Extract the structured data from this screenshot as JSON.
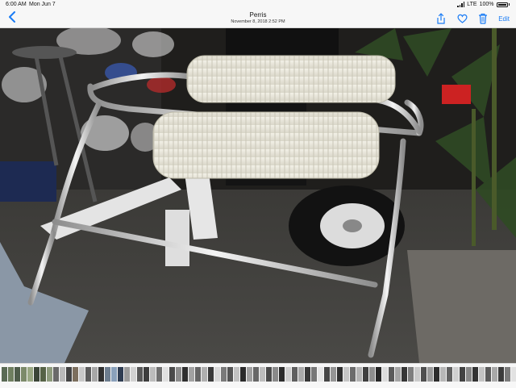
{
  "status_bar": {
    "time": "6:00 AM",
    "date": "Mon Jun 7",
    "carrier": "LTE",
    "battery": "100%",
    "battery_level": 1.0
  },
  "nav": {
    "title": "Perris",
    "subtitle": "November 8, 2018  2:52 PM",
    "edit_label": "Edit",
    "accent_color": "#1a7cf5"
  },
  "icons": {
    "back": "chevron-left-icon",
    "share": "share-icon",
    "favorite": "heart-icon",
    "delete": "trash-icon"
  },
  "filmstrip": {
    "thumbnail_colors": [
      "#5a6a55",
      "#6f7f60",
      "#4e5c4a",
      "#7c8a6a",
      "#9aa884",
      "#3b4538",
      "#566246",
      "#8e9b7d",
      "#6a6a6a",
      "#b9b9b9",
      "#444444",
      "#7d6f5e",
      "#c9c9c9",
      "#5d5d5d",
      "#a7a7a7",
      "#313131",
      "#6d7d8f",
      "#8aa1bb",
      "#2f3d52",
      "#9c9c9c",
      "#d2d2d2",
      "#585858",
      "#3d3d3d",
      "#bcbcbc",
      "#707070",
      "#e0e0e0",
      "#4a4a4a",
      "#8c8c8c",
      "#2e2e2e",
      "#a2a2a2",
      "#666666",
      "#b0b0b0",
      "#3a3a3a",
      "#d9d9d9",
      "#7a7a7a",
      "#555555",
      "#c2c2c2",
      "#2a2a2a",
      "#9f9f9f",
      "#676767",
      "#bdbdbd",
      "#4b4b4b",
      "#8a8a8a",
      "#2c2c2c",
      "#cfcfcf",
      "#5f5f5f",
      "#aaaaaa",
      "#383838",
      "#777777",
      "#e6e6e6",
      "#464646",
      "#959595",
      "#303030",
      "#c6c6c6",
      "#6b6b6b",
      "#b4b4b4",
      "#3f3f3f",
      "#8f8f8f",
      "#272727",
      "#dcdcdc",
      "#5a5a5a",
      "#a5a5a5",
      "#363636",
      "#7f7f7f",
      "#cbcbcb",
      "#4f4f4f",
      "#9a9a9a",
      "#2d2d2d",
      "#b7b7b7",
      "#616161",
      "#d0d0d0",
      "#424242",
      "#878787",
      "#333333",
      "#c4c4c4",
      "#5c5c5c",
      "#a9a9a9",
      "#3c3c3c",
      "#7b7b7b",
      "#e2e2e2",
      "#8a6d4e",
      "#6e5840"
    ]
  }
}
